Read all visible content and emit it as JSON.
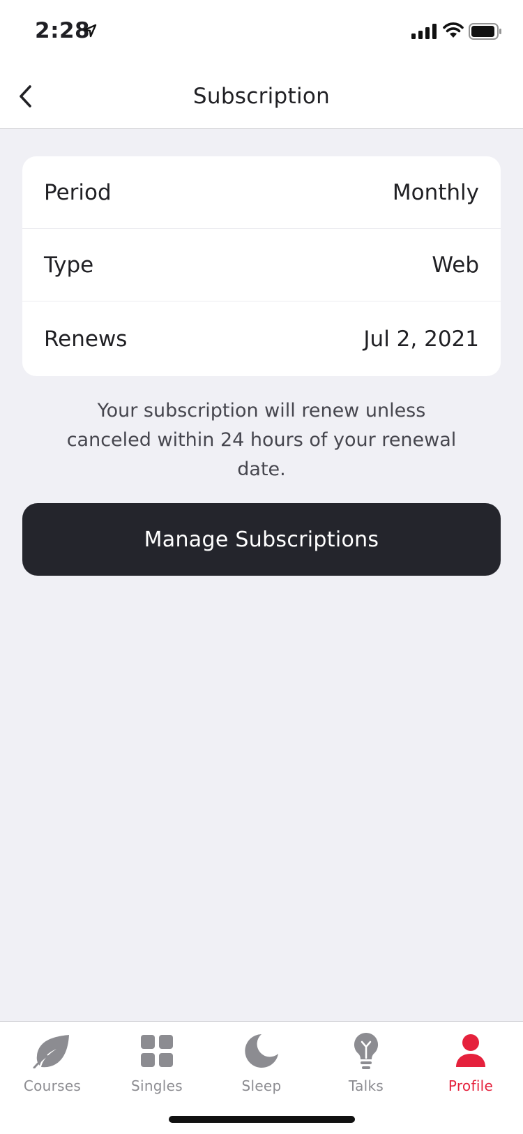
{
  "status_bar": {
    "time": "2:28"
  },
  "nav": {
    "title": "Subscription",
    "back_icon": "chevron-left-icon"
  },
  "details": [
    {
      "label": "Period",
      "value": "Monthly"
    },
    {
      "label": "Type",
      "value": "Web"
    },
    {
      "label": "Renews",
      "value": "Jul 2, 2021"
    }
  ],
  "note": "Your subscription will renew unless canceled within 24 hours of your renewal date.",
  "manage_button": "Manage Subscriptions",
  "tabs": [
    {
      "label": "Courses",
      "icon": "leaf-icon",
      "active": false
    },
    {
      "label": "Singles",
      "icon": "grid-icon",
      "active": false
    },
    {
      "label": "Sleep",
      "icon": "moon-icon",
      "active": false
    },
    {
      "label": "Talks",
      "icon": "lightbulb-icon",
      "active": false
    },
    {
      "label": "Profile",
      "icon": "person-icon",
      "active": true
    }
  ],
  "colors": {
    "accent": "#e5213c",
    "button_bg": "#24252c",
    "background": "#f0f0f5",
    "inactive_tab": "#8c8c91"
  }
}
